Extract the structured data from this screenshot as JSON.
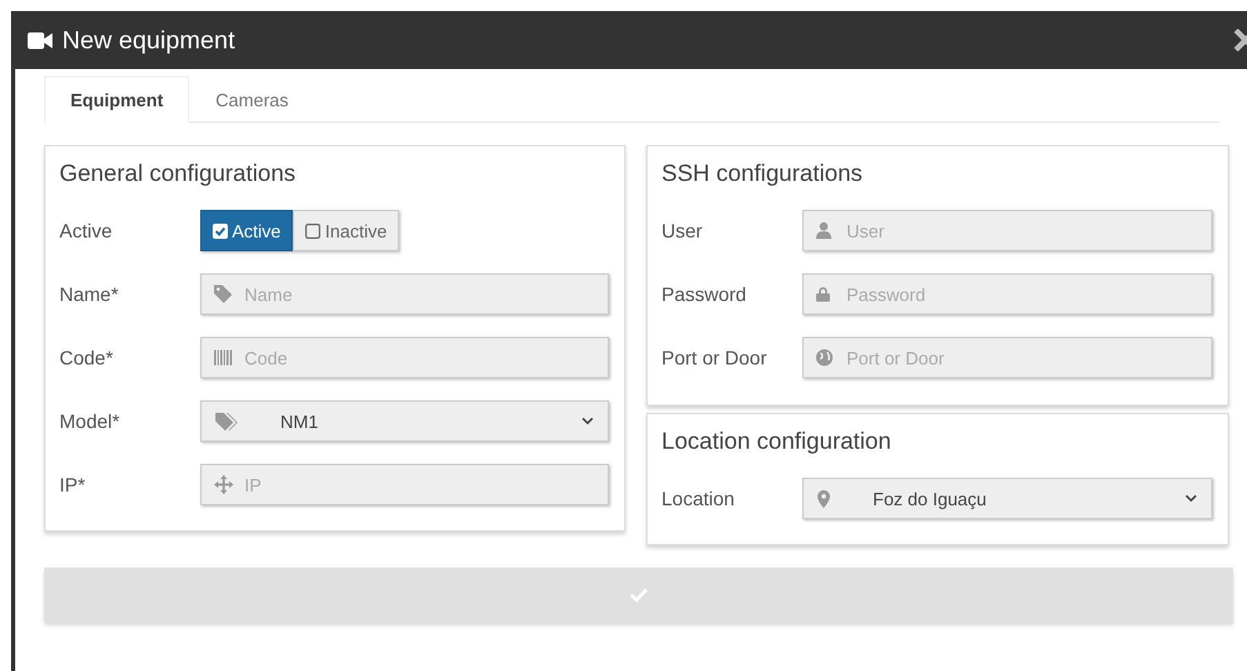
{
  "window": {
    "title": "New equipment"
  },
  "tabs": [
    {
      "label": "Equipment",
      "selected": true
    },
    {
      "label": "Cameras",
      "selected": false
    }
  ],
  "cards": [
    {
      "title": "General configurations",
      "fields": [
        {
          "kind": "toggle",
          "label": "Active",
          "options": [
            {
              "label": "Active",
              "selected": true
            },
            {
              "label": "Inactive",
              "selected": false
            }
          ]
        },
        {
          "kind": "input",
          "label": "Name*",
          "placeholder": "Name"
        },
        {
          "kind": "input",
          "label": "Code*",
          "placeholder": "Code"
        },
        {
          "kind": "select",
          "label": "Model*",
          "value": "NM1"
        },
        {
          "kind": "input",
          "label": "IP*",
          "placeholder": "IP"
        }
      ]
    },
    {
      "title": "SSH configurations",
      "fields": [
        {
          "kind": "input",
          "label": "User",
          "placeholder": "User"
        },
        {
          "kind": "input",
          "label": "Password",
          "placeholder": "Password"
        },
        {
          "kind": "input",
          "label": "Port or Door",
          "placeholder": "Port or Door"
        }
      ]
    },
    {
      "title": "Location configuration",
      "fields": [
        {
          "kind": "select",
          "label": "Location",
          "value": "Foz do Iguaçu"
        }
      ]
    }
  ]
}
